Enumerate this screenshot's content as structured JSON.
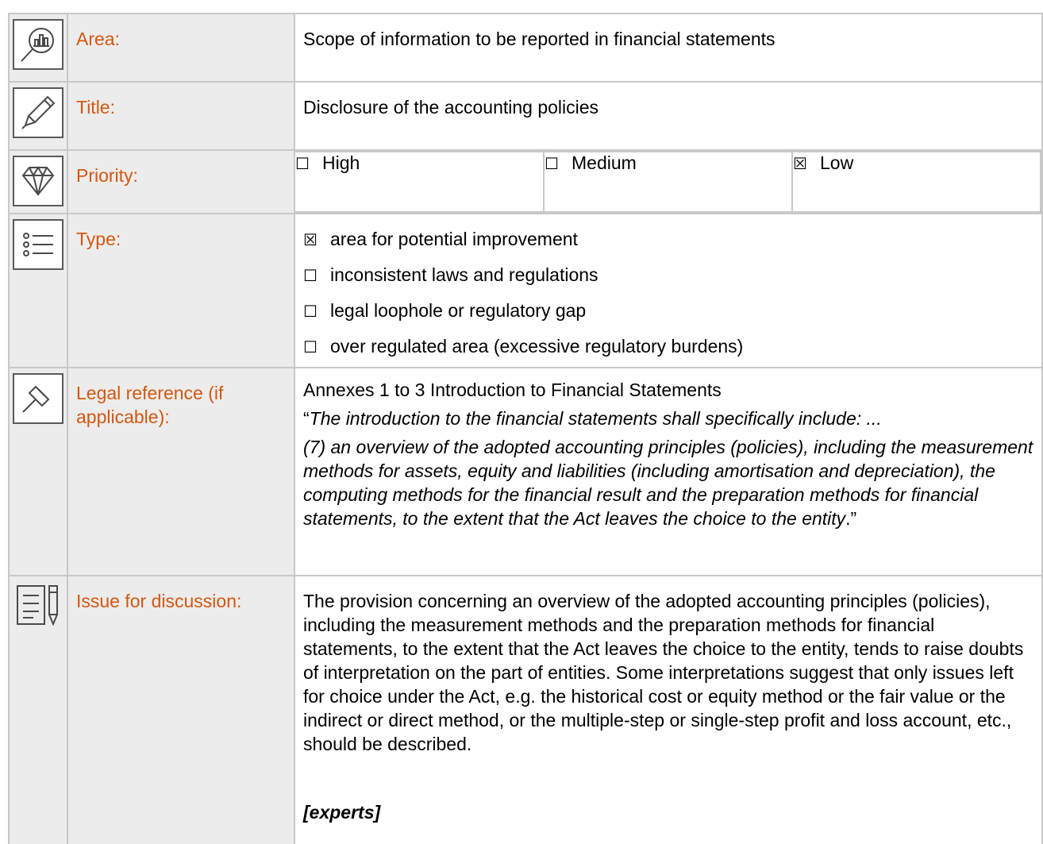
{
  "rows": {
    "area": {
      "label": "Area:",
      "value": "Scope of information to be reported in financial statements"
    },
    "title": {
      "label": "Title:",
      "value": "Disclosure of the accounting policies"
    },
    "priority": {
      "label": "Priority:",
      "options": [
        {
          "mark": "☐",
          "label": "High"
        },
        {
          "mark": "☐",
          "label": "Medium"
        },
        {
          "mark": "☒",
          "label": "Low"
        }
      ]
    },
    "type": {
      "label": "Type:",
      "options": [
        {
          "mark": "☒",
          "label": "area for potential improvement"
        },
        {
          "mark": "☐",
          "label": "inconsistent laws and regulations"
        },
        {
          "mark": "☐",
          "label": "legal loophole or regulatory gap"
        },
        {
          "mark": "☐",
          "label": "over regulated area (excessive regulatory burdens)"
        }
      ]
    },
    "legal": {
      "label": "Legal reference (if applicable):",
      "heading": "Annexes 1 to 3 Introduction to Financial Statements",
      "open_quote": "“",
      "quote_line1": "The introduction to the financial statements shall specifically include: ...",
      "quote_line2": "(7) an overview of the adopted accounting principles (policies), including the measurement methods for assets, equity and liabilities (including amortisation and depreciation), the computing methods for the financial result and the preparation methods for financial statements, to the extent that the Act leaves the choice to the entity",
      "close_quote": ".”"
    },
    "issue": {
      "label": "Issue for discussion:",
      "text": "The provision concerning an overview of the adopted accounting principles (policies), including the measurement methods and the preparation methods for financial statements, to the extent that the Act leaves the choice to the entity, tends to raise doubts of interpretation on the part of entities. Some interpretations suggest that only issues left for choice under the Act, e.g. the historical cost or equity method or the fair value or the indirect or direct method, or the multiple-step or single-step profit and loss account, etc., should be described.",
      "experts": "[experts]"
    }
  },
  "icons": {
    "area": "magnifier-chart-icon",
    "title": "pencil-icon",
    "priority": "diamond-icon",
    "type": "list-icon",
    "legal": "gavel-icon",
    "issue": "document-pen-icon"
  },
  "colors": {
    "label": "#d4570f",
    "label_bg": "#ececec",
    "border": "#c8c8c8"
  }
}
